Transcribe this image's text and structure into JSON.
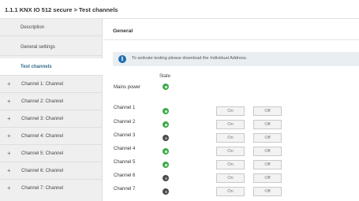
{
  "breadcrumb": "1.1.1 KNX IO 512 secure > Test channels",
  "sidebar": {
    "items": [
      {
        "label": "Description"
      },
      {
        "label": "General settings"
      },
      {
        "label": "Test channels"
      },
      {
        "label": "Channel 1: Channel"
      },
      {
        "label": "Channel 2: Channel"
      },
      {
        "label": "Channel 3: Channel"
      },
      {
        "label": "Channel 4: Channel"
      },
      {
        "label": "Channel 5: Channel"
      },
      {
        "label": "Channel 6: Channel"
      },
      {
        "label": "Channel 7: Channel"
      }
    ],
    "expand_glyph": "+"
  },
  "main": {
    "section_title": "General",
    "info_text": "To activate testing please download the Individual Address.",
    "info_icon": "i",
    "state_header": "State",
    "mains_power": {
      "label": "Mains power",
      "state": "on"
    },
    "channels": [
      {
        "label": "Channel 1",
        "state": "on",
        "on_label": "On",
        "off_label": "Off"
      },
      {
        "label": "Channel 2",
        "state": "on",
        "on_label": "On",
        "off_label": "Off"
      },
      {
        "label": "Channel 3",
        "state": "off",
        "on_label": "On",
        "off_label": "Off"
      },
      {
        "label": "Channel 4",
        "state": "on",
        "on_label": "On",
        "off_label": "Off"
      },
      {
        "label": "Channel 5",
        "state": "on",
        "on_label": "On",
        "off_label": "Off"
      },
      {
        "label": "Channel 6",
        "state": "off",
        "on_label": "On",
        "off_label": "Off"
      },
      {
        "label": "Channel 7",
        "state": "off",
        "on_label": "On",
        "off_label": "Off"
      }
    ]
  },
  "colors": {
    "active_text": "#2f6e8e",
    "state_on": "#3daa4a",
    "state_off": "#4a4a4a",
    "info_icon": "#1f6fb0"
  }
}
